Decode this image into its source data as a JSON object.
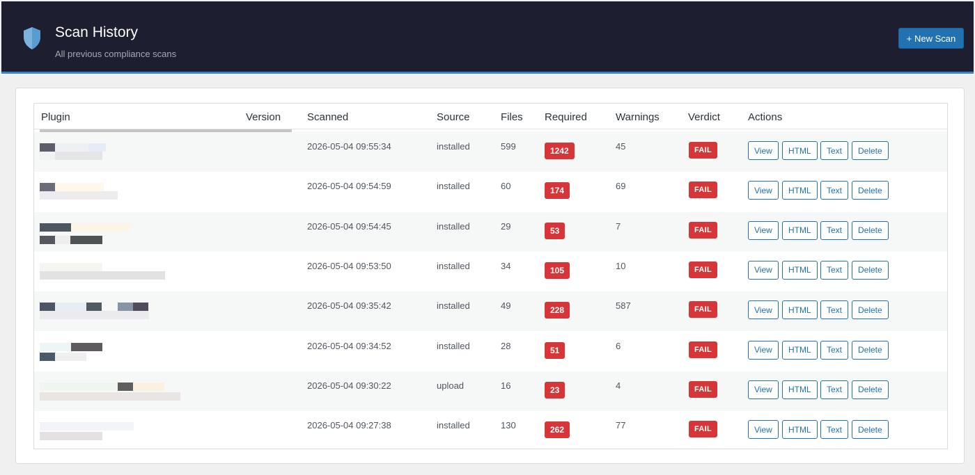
{
  "header": {
    "title": "Scan History",
    "subtitle": "All previous compliance scans",
    "new_scan_label": "+ New Scan",
    "icon": "shield-icon",
    "bg_color": "#1d1f31",
    "accent_color": "#2271b1"
  },
  "table": {
    "columns": [
      "Plugin",
      "Version",
      "Scanned",
      "Source",
      "Files",
      "Required",
      "Warnings",
      "Verdict",
      "Actions"
    ],
    "actions": [
      "View",
      "HTML",
      "Text",
      "Delete"
    ],
    "rows": [
      {
        "scanned": "2026-05-04 09:55:34",
        "source": "installed",
        "files": "599",
        "required": "1242",
        "warnings": "45",
        "verdict": "FAIL"
      },
      {
        "scanned": "2026-05-04 09:54:59",
        "source": "installed",
        "files": "60",
        "required": "174",
        "warnings": "69",
        "verdict": "FAIL"
      },
      {
        "scanned": "2026-05-04 09:54:45",
        "source": "installed",
        "files": "29",
        "required": "53",
        "warnings": "7",
        "verdict": "FAIL"
      },
      {
        "scanned": "2026-05-04 09:53:50",
        "source": "installed",
        "files": "34",
        "required": "105",
        "warnings": "10",
        "verdict": "FAIL"
      },
      {
        "scanned": "2026-05-04 09:35:42",
        "source": "installed",
        "files": "49",
        "required": "228",
        "warnings": "587",
        "verdict": "FAIL"
      },
      {
        "scanned": "2026-05-04 09:34:52",
        "source": "installed",
        "files": "28",
        "required": "51",
        "warnings": "6",
        "verdict": "FAIL"
      },
      {
        "scanned": "2026-05-04 09:30:22",
        "source": "upload",
        "files": "16",
        "required": "23",
        "warnings": "4",
        "verdict": "FAIL"
      },
      {
        "scanned": "2026-05-04 09:27:38",
        "source": "installed",
        "files": "130",
        "required": "262",
        "warnings": "77",
        "verdict": "FAIL"
      }
    ]
  },
  "colors": {
    "fail": "#d63638",
    "button_border": "#2271b1"
  }
}
